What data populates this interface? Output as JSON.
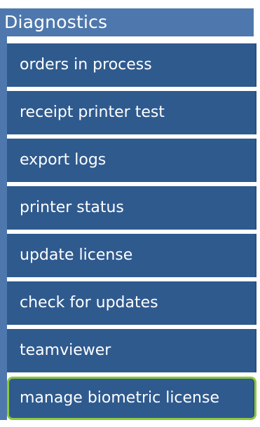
{
  "header": {
    "title": "Diagnostics"
  },
  "menu": {
    "items": [
      {
        "label": "orders in process"
      },
      {
        "label": "receipt printer test"
      },
      {
        "label": "export logs"
      },
      {
        "label": "printer status"
      },
      {
        "label": "update license"
      },
      {
        "label": "check for updates"
      },
      {
        "label": "teamviewer"
      },
      {
        "label": "manage biometric license",
        "selected": true
      }
    ]
  },
  "colors": {
    "header_bg": "#4e78ad",
    "item_bg": "#2f5a8e",
    "item_text": "#ffffff",
    "selected_outline": "#8cc63f"
  }
}
